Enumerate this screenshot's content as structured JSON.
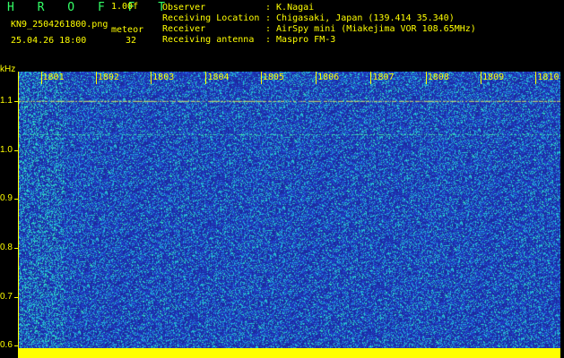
{
  "header": {
    "brand": "H R O F F T",
    "version": "1.00f",
    "filename": "KN9_2504261800.png",
    "meteor_label": "meteor",
    "timestamp": "25.04.26 18:00",
    "meteor_count": "32",
    "info": [
      {
        "key": "Observer",
        "value": ": K.Nagai"
      },
      {
        "key": "Receiving Location",
        "value": ": Chigasaki, Japan (139.414 35.340)"
      },
      {
        "key": "Receiver",
        "value": ": AirSpy mini (Miakejima VOR 108.65MHz)"
      },
      {
        "key": "Receiving antenna",
        "value": ": Maspro FM-3"
      }
    ]
  },
  "chart_data": {
    "type": "heatmap",
    "ylabel": "kHz",
    "y_ticks": [
      "1.1",
      "1.0",
      "0.9",
      "0.8",
      "0.7",
      "0.6"
    ],
    "y_values": [
      1.1,
      1.0,
      0.9,
      0.8,
      0.7,
      0.6
    ],
    "ylim": [
      0.575,
      1.16
    ],
    "x_ticks": [
      "1801",
      "1802",
      "1803",
      "1804",
      "1805",
      "1806",
      "1807",
      "1808",
      "1809",
      "1810"
    ],
    "x_values": [
      1801,
      1802,
      1803,
      1804,
      1805,
      1806,
      1807,
      1808,
      1809,
      1810
    ],
    "xlim": [
      1800.6,
      1810.45
    ],
    "colors": {
      "background": "#1c2aa0",
      "noise_low": "#2244cc",
      "noise_mid": "#20b0e0",
      "noise_high": "#30e0c0",
      "signal": "#ffff00"
    },
    "carrier_lines_khz": [
      1.1,
      1.032
    ]
  }
}
